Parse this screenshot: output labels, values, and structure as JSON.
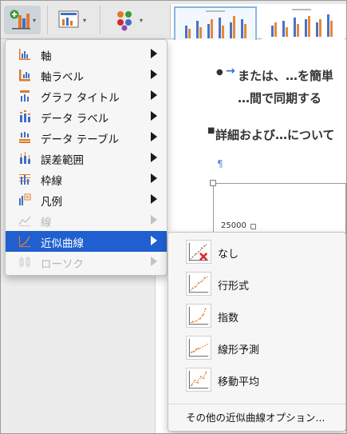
{
  "colors": {
    "highlight": "#1f5fd0",
    "icon_orange": "#e0792a",
    "icon_blue": "#3f6fc4",
    "disabled_text": "#b5b5b5",
    "delete_red": "#d9262b",
    "thumb_bar_blue": "#4a72c2",
    "thumb_bar_orange": "#e6883a"
  },
  "ribbon": {
    "add_element_icon": "add-chart-element-icon",
    "quick_layout_icon": "quick-layout-icon",
    "change_colors_icon": "change-colors-icon",
    "caret": "▾"
  },
  "menu": {
    "items": [
      {
        "label": "軸",
        "icon": "axes-icon",
        "disabled": false,
        "highlighted": false
      },
      {
        "label": "軸ラベル",
        "icon": "axis-titles-icon",
        "disabled": false,
        "highlighted": false
      },
      {
        "label": "グラフ タイトル",
        "icon": "chart-title-icon",
        "disabled": false,
        "highlighted": false
      },
      {
        "label": "データ ラベル",
        "icon": "data-labels-icon",
        "disabled": false,
        "highlighted": false
      },
      {
        "label": "データ テーブル",
        "icon": "data-table-icon",
        "disabled": false,
        "highlighted": false
      },
      {
        "label": "誤差範囲",
        "icon": "error-bars-icon",
        "disabled": false,
        "highlighted": false
      },
      {
        "label": "枠線",
        "icon": "gridlines-icon",
        "disabled": false,
        "highlighted": false
      },
      {
        "label": "凡例",
        "icon": "legend-icon",
        "disabled": false,
        "highlighted": false
      },
      {
        "label": "線",
        "icon": "lines-icon",
        "disabled": true,
        "highlighted": false
      },
      {
        "label": "近似曲線",
        "icon": "trendline-icon",
        "disabled": false,
        "highlighted": true
      },
      {
        "label": "ローソク",
        "icon": "up-down-bars-icon",
        "disabled": true,
        "highlighted": false
      }
    ]
  },
  "submenu": {
    "items": [
      {
        "label": "なし",
        "icon": "trendline-none-icon"
      },
      {
        "label": "行形式",
        "icon": "trendline-linear-icon"
      },
      {
        "label": "指数",
        "icon": "trendline-exponential-icon"
      },
      {
        "label": "線形予測",
        "icon": "trendline-linear-forecast-icon"
      },
      {
        "label": "移動平均",
        "icon": "trendline-moving-average-icon"
      }
    ],
    "more_options": "その他の近似曲線オプション..."
  },
  "document": {
    "line1": "または、…を簡単",
    "line2": "…間で同期する",
    "line3": "詳細および…について",
    "pilcrow": "¶",
    "axis_tick": "25000",
    "bullet_arrow": "→"
  }
}
